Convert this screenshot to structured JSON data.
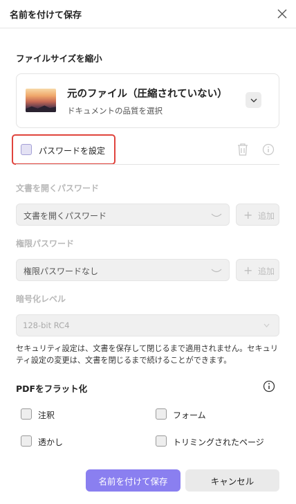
{
  "dialog": {
    "title": "名前を付けて保存"
  },
  "compress": {
    "heading": "ファイルサイズを縮小",
    "option_title": "元のファイル（圧縮されていない）",
    "option_subtitle": "ドキュメントの品質を選択"
  },
  "password": {
    "checkbox_label": "パスワードを設定",
    "checked": false,
    "open_heading": "文書を開くパスワード",
    "open_placeholder": "文書を開くパスワード",
    "open_add": "追加",
    "permission_heading": "権限パスワード",
    "permission_value": "権限パスワードなし",
    "permission_add": "追加",
    "encryption_heading": "暗号化レベル",
    "encryption_value": "128-bit RC4",
    "note": "セキュリティ設定は、文書を保存して閉じるまで適用されません。セキュリティ設定の変更は、文書を閉じるまで続けることができます。"
  },
  "flatten": {
    "heading": "PDFをフラット化",
    "options": [
      "注釈",
      "フォーム",
      "透かし",
      "トリミングされたページ"
    ]
  },
  "buttons": {
    "save": "名前を付けて保存",
    "cancel": "キャンセル"
  },
  "colors": {
    "accent": "#8a7ff0",
    "highlight": "#e0433c"
  }
}
